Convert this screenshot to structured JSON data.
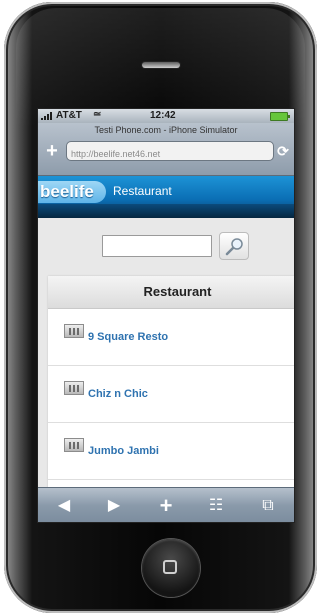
{
  "status_bar": {
    "carrier": "AT&T",
    "wifi_icon": "≃",
    "time": "12:42"
  },
  "browser": {
    "page_title": "Testi Phone.com - iPhone Simulator",
    "add_icon": "+",
    "url": "http://beelife.net46.net",
    "reload_icon": "⟳"
  },
  "site": {
    "logo_text": "beelife",
    "header_title": "Restaurant"
  },
  "search": {
    "value": "",
    "placeholder": ""
  },
  "list": {
    "header": "Restaurant",
    "items": [
      {
        "label": "9 Square Resto",
        "icon": "restaurant-thumbnail-icon"
      },
      {
        "label": "Chiz n Chic",
        "icon": "restaurant-thumbnail-icon"
      },
      {
        "label": "Jumbo Jambi",
        "icon": "restaurant-thumbnail-icon"
      }
    ]
  },
  "toolbar": {
    "back_icon": "◀",
    "forward_icon": "▶",
    "add_icon": "+",
    "bookmarks_icon": "☷",
    "pages_icon": "⧉"
  },
  "colors": {
    "header_blue": "#0b6fb5",
    "link_blue": "#2f73b0"
  }
}
